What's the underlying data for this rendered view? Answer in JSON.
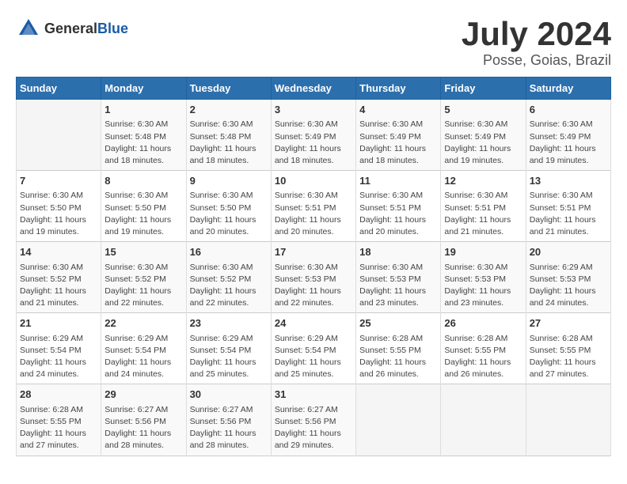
{
  "header": {
    "logo_general": "General",
    "logo_blue": "Blue",
    "title": "July 2024",
    "subtitle": "Posse, Goias, Brazil"
  },
  "days_of_week": [
    "Sunday",
    "Monday",
    "Tuesday",
    "Wednesday",
    "Thursday",
    "Friday",
    "Saturday"
  ],
  "weeks": [
    [
      {
        "date": "",
        "detail": ""
      },
      {
        "date": "1",
        "detail": "Sunrise: 6:30 AM\nSunset: 5:48 PM\nDaylight: 11 hours\nand 18 minutes."
      },
      {
        "date": "2",
        "detail": "Sunrise: 6:30 AM\nSunset: 5:48 PM\nDaylight: 11 hours\nand 18 minutes."
      },
      {
        "date": "3",
        "detail": "Sunrise: 6:30 AM\nSunset: 5:49 PM\nDaylight: 11 hours\nand 18 minutes."
      },
      {
        "date": "4",
        "detail": "Sunrise: 6:30 AM\nSunset: 5:49 PM\nDaylight: 11 hours\nand 18 minutes."
      },
      {
        "date": "5",
        "detail": "Sunrise: 6:30 AM\nSunset: 5:49 PM\nDaylight: 11 hours\nand 19 minutes."
      },
      {
        "date": "6",
        "detail": "Sunrise: 6:30 AM\nSunset: 5:49 PM\nDaylight: 11 hours\nand 19 minutes."
      }
    ],
    [
      {
        "date": "7",
        "detail": "Sunrise: 6:30 AM\nSunset: 5:50 PM\nDaylight: 11 hours\nand 19 minutes."
      },
      {
        "date": "8",
        "detail": "Sunrise: 6:30 AM\nSunset: 5:50 PM\nDaylight: 11 hours\nand 19 minutes."
      },
      {
        "date": "9",
        "detail": "Sunrise: 6:30 AM\nSunset: 5:50 PM\nDaylight: 11 hours\nand 20 minutes."
      },
      {
        "date": "10",
        "detail": "Sunrise: 6:30 AM\nSunset: 5:51 PM\nDaylight: 11 hours\nand 20 minutes."
      },
      {
        "date": "11",
        "detail": "Sunrise: 6:30 AM\nSunset: 5:51 PM\nDaylight: 11 hours\nand 20 minutes."
      },
      {
        "date": "12",
        "detail": "Sunrise: 6:30 AM\nSunset: 5:51 PM\nDaylight: 11 hours\nand 21 minutes."
      },
      {
        "date": "13",
        "detail": "Sunrise: 6:30 AM\nSunset: 5:51 PM\nDaylight: 11 hours\nand 21 minutes."
      }
    ],
    [
      {
        "date": "14",
        "detail": "Sunrise: 6:30 AM\nSunset: 5:52 PM\nDaylight: 11 hours\nand 21 minutes."
      },
      {
        "date": "15",
        "detail": "Sunrise: 6:30 AM\nSunset: 5:52 PM\nDaylight: 11 hours\nand 22 minutes."
      },
      {
        "date": "16",
        "detail": "Sunrise: 6:30 AM\nSunset: 5:52 PM\nDaylight: 11 hours\nand 22 minutes."
      },
      {
        "date": "17",
        "detail": "Sunrise: 6:30 AM\nSunset: 5:53 PM\nDaylight: 11 hours\nand 22 minutes."
      },
      {
        "date": "18",
        "detail": "Sunrise: 6:30 AM\nSunset: 5:53 PM\nDaylight: 11 hours\nand 23 minutes."
      },
      {
        "date": "19",
        "detail": "Sunrise: 6:30 AM\nSunset: 5:53 PM\nDaylight: 11 hours\nand 23 minutes."
      },
      {
        "date": "20",
        "detail": "Sunrise: 6:29 AM\nSunset: 5:53 PM\nDaylight: 11 hours\nand 24 minutes."
      }
    ],
    [
      {
        "date": "21",
        "detail": "Sunrise: 6:29 AM\nSunset: 5:54 PM\nDaylight: 11 hours\nand 24 minutes."
      },
      {
        "date": "22",
        "detail": "Sunrise: 6:29 AM\nSunset: 5:54 PM\nDaylight: 11 hours\nand 24 minutes."
      },
      {
        "date": "23",
        "detail": "Sunrise: 6:29 AM\nSunset: 5:54 PM\nDaylight: 11 hours\nand 25 minutes."
      },
      {
        "date": "24",
        "detail": "Sunrise: 6:29 AM\nSunset: 5:54 PM\nDaylight: 11 hours\nand 25 minutes."
      },
      {
        "date": "25",
        "detail": "Sunrise: 6:28 AM\nSunset: 5:55 PM\nDaylight: 11 hours\nand 26 minutes."
      },
      {
        "date": "26",
        "detail": "Sunrise: 6:28 AM\nSunset: 5:55 PM\nDaylight: 11 hours\nand 26 minutes."
      },
      {
        "date": "27",
        "detail": "Sunrise: 6:28 AM\nSunset: 5:55 PM\nDaylight: 11 hours\nand 27 minutes."
      }
    ],
    [
      {
        "date": "28",
        "detail": "Sunrise: 6:28 AM\nSunset: 5:55 PM\nDaylight: 11 hours\nand 27 minutes."
      },
      {
        "date": "29",
        "detail": "Sunrise: 6:27 AM\nSunset: 5:56 PM\nDaylight: 11 hours\nand 28 minutes."
      },
      {
        "date": "30",
        "detail": "Sunrise: 6:27 AM\nSunset: 5:56 PM\nDaylight: 11 hours\nand 28 minutes."
      },
      {
        "date": "31",
        "detail": "Sunrise: 6:27 AM\nSunset: 5:56 PM\nDaylight: 11 hours\nand 29 minutes."
      },
      {
        "date": "",
        "detail": ""
      },
      {
        "date": "",
        "detail": ""
      },
      {
        "date": "",
        "detail": ""
      }
    ]
  ]
}
